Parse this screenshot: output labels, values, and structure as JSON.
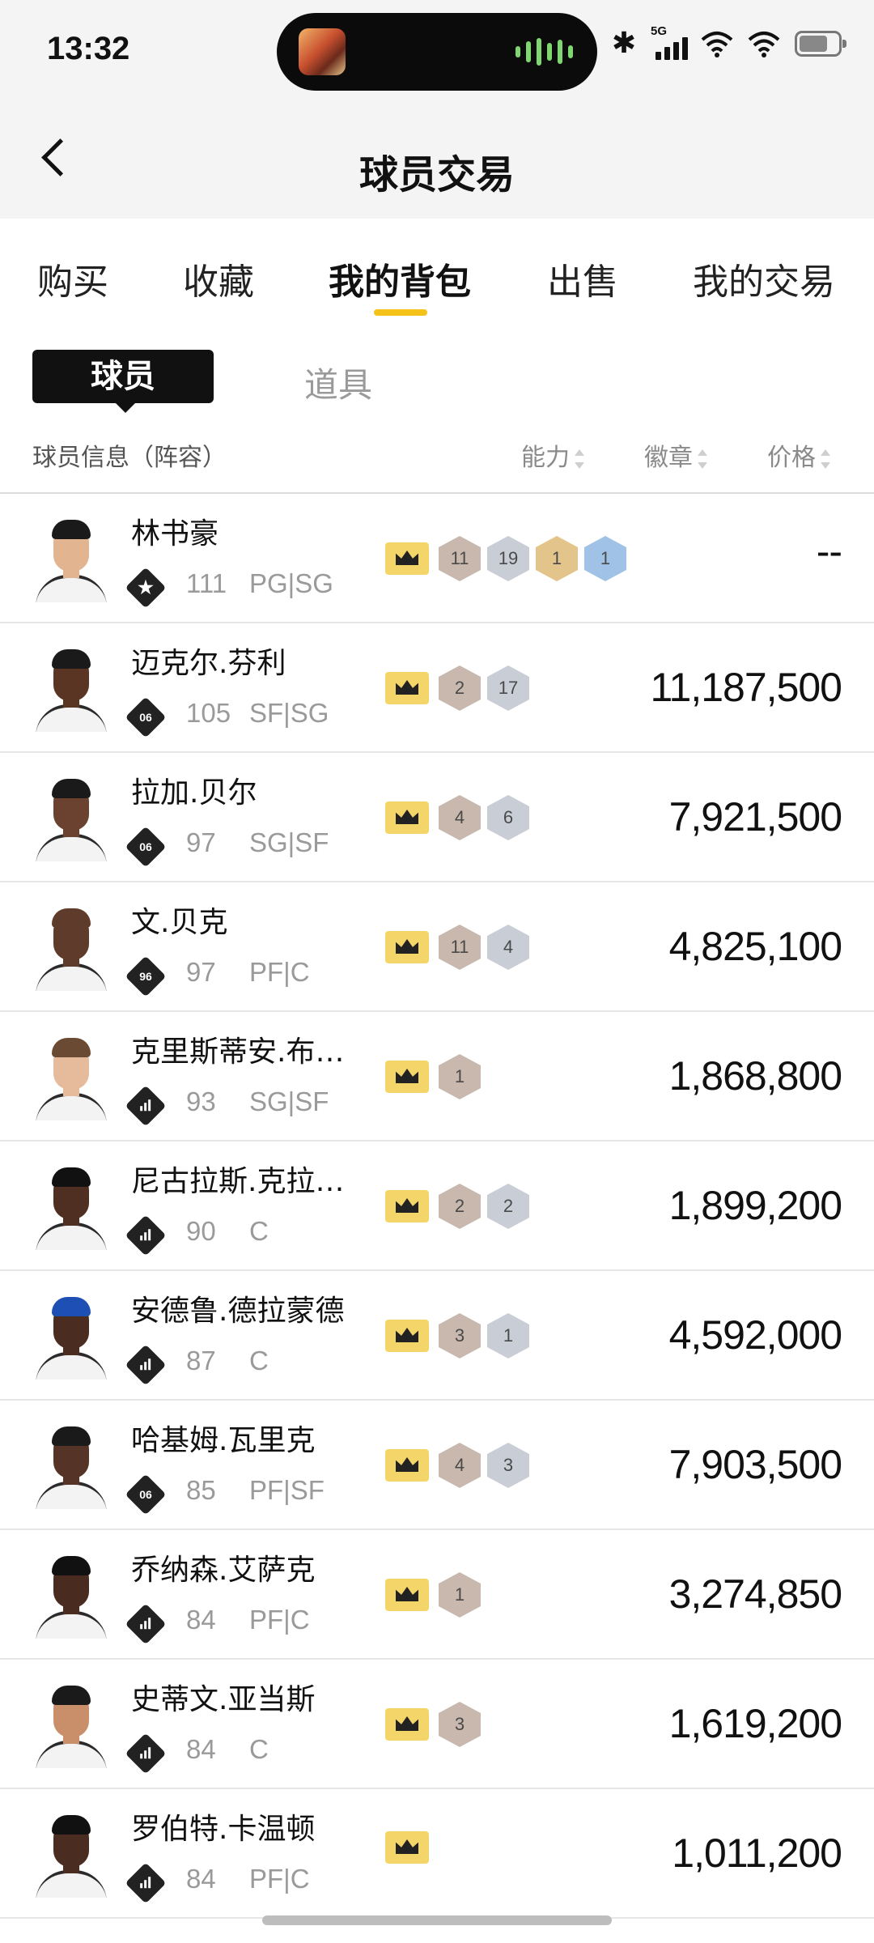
{
  "status_bar": {
    "time": "13:32",
    "network": "5G",
    "icons": [
      "bluetooth-icon",
      "signal-icon",
      "wifi-icon",
      "wifi-icon",
      "battery-icon"
    ]
  },
  "header": {
    "title": "球员交易",
    "back_icon": "chevron-left-icon"
  },
  "tabs": [
    {
      "label": "购买",
      "active": false
    },
    {
      "label": "收藏",
      "active": false
    },
    {
      "label": "我的背包",
      "active": true
    },
    {
      "label": "出售",
      "active": false
    },
    {
      "label": "我的交易",
      "active": false
    }
  ],
  "segments": {
    "active": "球员",
    "inactive": "道具"
  },
  "columns": {
    "info": "球员信息（阵容）",
    "ability": "能力",
    "badges": "徽章",
    "price": "价格"
  },
  "colors": {
    "accent": "#f5c21a",
    "crown_bg": "#f3d56a",
    "bronze": "#c9b8ad",
    "silver": "#c8cdd6",
    "gold": "#e3c48a",
    "blue": "#9fc2e6"
  },
  "players": [
    {
      "name": "林书豪",
      "rating_icon": "star",
      "ability": "111",
      "pos": "PG|SG",
      "badges": [
        {
          "n": "11",
          "c": "bronze"
        },
        {
          "n": "19",
          "c": "silver"
        },
        {
          "n": "1",
          "c": "gold"
        },
        {
          "n": "1",
          "c": "blue"
        }
      ],
      "price": "--",
      "skin": "#e2b48f",
      "hair": "#1a1a1a"
    },
    {
      "name": "迈克尔.芬利",
      "rating_icon": "06",
      "ability": "105",
      "pos": "SF|SG",
      "badges": [
        {
          "n": "2",
          "c": "bronze"
        },
        {
          "n": "17",
          "c": "silver"
        }
      ],
      "price": "11,187,500",
      "skin": "#5a3524",
      "hair": "#1a1a1a"
    },
    {
      "name": "拉加.贝尔",
      "rating_icon": "06",
      "ability": "97",
      "pos": "SG|SF",
      "badges": [
        {
          "n": "4",
          "c": "bronze"
        },
        {
          "n": "6",
          "c": "silver"
        }
      ],
      "price": "7,921,500",
      "skin": "#6b4130",
      "hair": "#1a1a1a"
    },
    {
      "name": "文.贝克",
      "rating_icon": "96",
      "ability": "97",
      "pos": "PF|C",
      "badges": [
        {
          "n": "11",
          "c": "bronze"
        },
        {
          "n": "4",
          "c": "silver"
        }
      ],
      "price": "4,825,100",
      "skin": "#5e3b2b",
      "hair": "#5e3b2b"
    },
    {
      "name": "克里斯蒂安.布…",
      "rating_icon": "bars",
      "ability": "93",
      "pos": "SG|SF",
      "badges": [
        {
          "n": "1",
          "c": "bronze"
        }
      ],
      "price": "1,868,800",
      "skin": "#e5bb9c",
      "hair": "#6a4a32"
    },
    {
      "name": "尼古拉斯.克拉…",
      "rating_icon": "bars",
      "ability": "90",
      "pos": "C",
      "badges": [
        {
          "n": "2",
          "c": "bronze"
        },
        {
          "n": "2",
          "c": "silver"
        }
      ],
      "price": "1,899,200",
      "skin": "#4e2f22",
      "hair": "#111111"
    },
    {
      "name": "安德鲁.德拉蒙德",
      "rating_icon": "bars",
      "ability": "87",
      "pos": "C",
      "badges": [
        {
          "n": "3",
          "c": "bronze"
        },
        {
          "n": "1",
          "c": "silver"
        }
      ],
      "price": "4,592,000",
      "skin": "#4a2c20",
      "hair": "#1e4fb5"
    },
    {
      "name": "哈基姆.瓦里克",
      "rating_icon": "06",
      "ability": "85",
      "pos": "PF|SF",
      "badges": [
        {
          "n": "4",
          "c": "bronze"
        },
        {
          "n": "3",
          "c": "silver"
        }
      ],
      "price": "7,903,500",
      "skin": "#553427",
      "hair": "#1a1a1a"
    },
    {
      "name": "乔纳森.艾萨克",
      "rating_icon": "bars",
      "ability": "84",
      "pos": "PF|C",
      "badges": [
        {
          "n": "1",
          "c": "bronze"
        }
      ],
      "price": "3,274,850",
      "skin": "#4a2b1f",
      "hair": "#111111"
    },
    {
      "name": "史蒂文.亚当斯",
      "rating_icon": "bars",
      "ability": "84",
      "pos": "C",
      "badges": [
        {
          "n": "3",
          "c": "bronze"
        }
      ],
      "price": "1,619,200",
      "skin": "#c98f6a",
      "hair": "#1a1a1a"
    },
    {
      "name": "罗伯特.卡温顿",
      "rating_icon": "bars",
      "ability": "84",
      "pos": "PF|C",
      "badges": [],
      "price": "1,011,200",
      "skin": "#4b2c20",
      "hair": "#111111"
    }
  ]
}
